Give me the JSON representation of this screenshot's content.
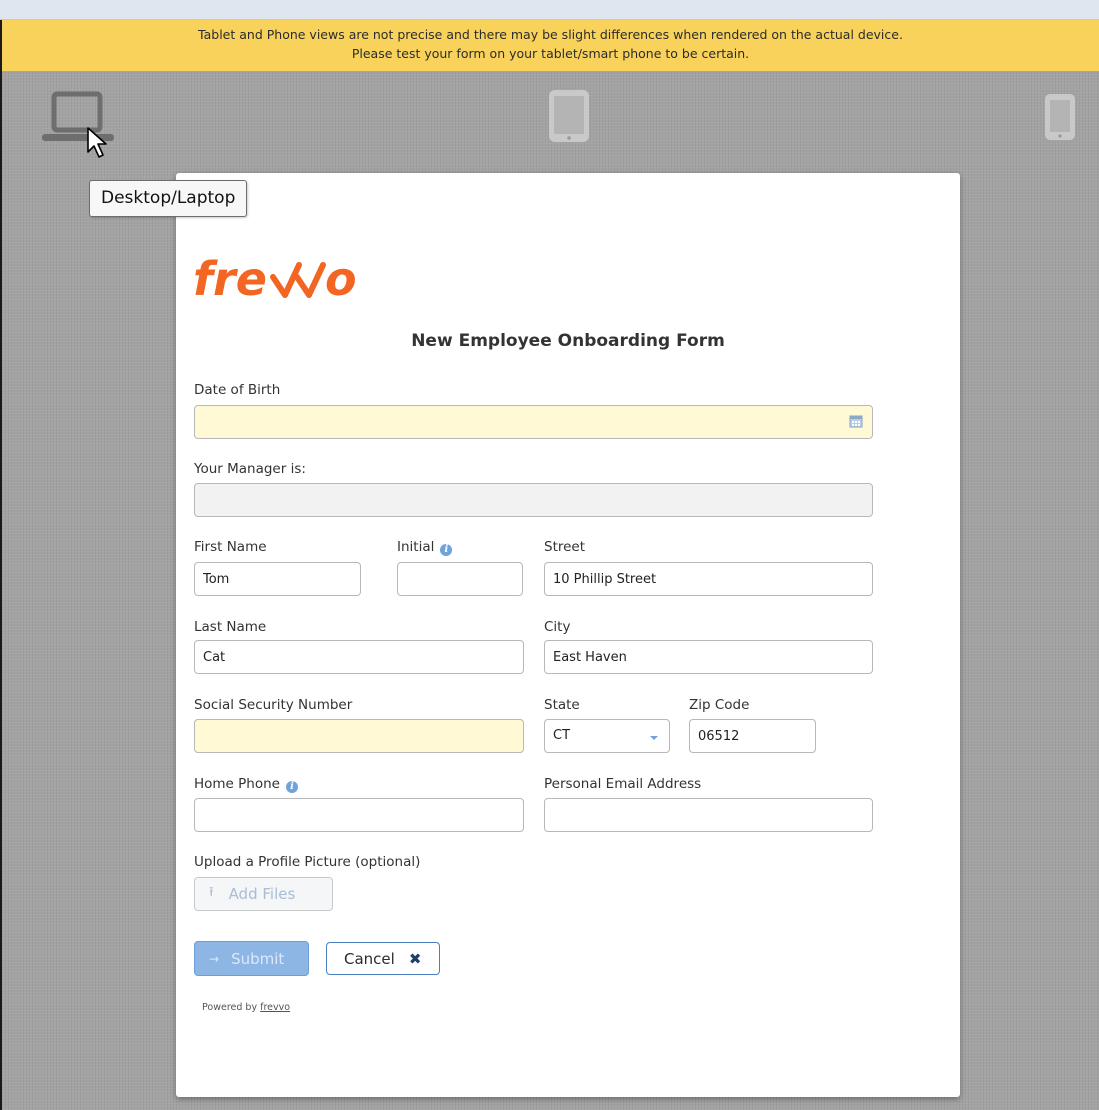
{
  "banner": {
    "line1": "Tablet and Phone views are not precise and there may be slight differences when rendered on the actual device.",
    "line2": "Please test your form on your tablet/smart phone to be certain."
  },
  "devices": {
    "desktop_icon": "laptop-icon",
    "tablet_icon": "tablet-icon",
    "phone_icon": "phone-icon",
    "tooltip": "Desktop/Laptop"
  },
  "form": {
    "logo_text": "frevvo",
    "title": "New Employee Onboarding Form",
    "date_of_birth": {
      "label": "Date of Birth",
      "value": ""
    },
    "manager": {
      "label": "Your Manager is:",
      "value": ""
    },
    "first_name": {
      "label": "First Name",
      "value": "Tom"
    },
    "initial": {
      "label": "Initial",
      "value": ""
    },
    "street": {
      "label": "Street",
      "value": "10 Phillip Street"
    },
    "last_name": {
      "label": "Last Name",
      "value": "Cat"
    },
    "city": {
      "label": "City",
      "value": "East Haven"
    },
    "ssn": {
      "label": "Social Security Number",
      "value": ""
    },
    "state": {
      "label": "State",
      "value": "CT"
    },
    "zip": {
      "label": "Zip Code",
      "value": "06512"
    },
    "home_phone": {
      "label": "Home Phone",
      "value": ""
    },
    "email": {
      "label": "Personal Email Address",
      "value": ""
    },
    "upload": {
      "label": "Upload a Profile Picture (optional)",
      "button": "Add Files"
    },
    "submit": "Submit",
    "cancel": "Cancel",
    "powered_prefix": "Powered by",
    "powered_link": "frevvo"
  },
  "colors": {
    "banner": "#f9d25b",
    "logo": "#f26522",
    "required_bg": "#fff9d6",
    "submit": "#8db6e4"
  }
}
